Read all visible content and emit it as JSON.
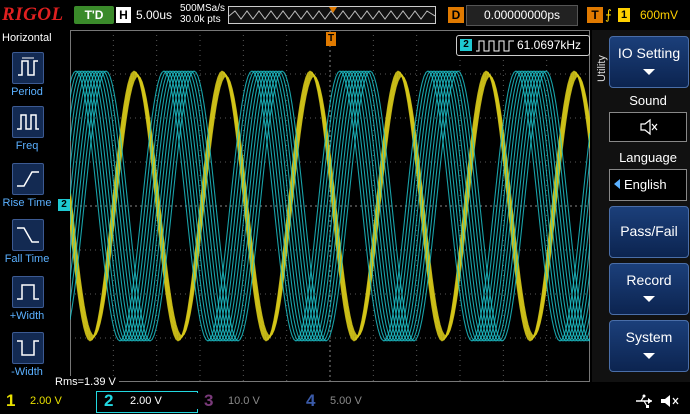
{
  "header": {
    "brand": "RIGOL",
    "run_state": "T'D",
    "h_label": "H",
    "timebase": "5.00us",
    "sample_rate": "500MSa/s",
    "memory_depth": "30.0k pts",
    "d_label": "D",
    "delay": "0.00000000ps",
    "t_label": "T",
    "trigger_channel": "1",
    "trigger_level": "600mV"
  },
  "sidebar": {
    "title": "Horizontal",
    "items": [
      {
        "label": "Period",
        "icon": "period-icon"
      },
      {
        "label": "Freq",
        "icon": "freq-icon"
      },
      {
        "label": "Rise Time",
        "icon": "rise-time-icon"
      },
      {
        "label": "Fall Time",
        "icon": "fall-time-icon"
      },
      {
        "label": "+Width",
        "icon": "pos-width-icon"
      },
      {
        "label": "-Width",
        "icon": "neg-width-icon"
      }
    ]
  },
  "screen": {
    "ch2_marker": "2",
    "trigger_marker": "T",
    "frequency_badge": "2",
    "frequency": "61.0697kHz",
    "rms": "Rms=1.39 V"
  },
  "menu": {
    "side_label": "Utility",
    "io_setting": "IO Setting",
    "sound": "Sound",
    "language": "Language",
    "language_value": "English",
    "pass_fail": "Pass/Fail",
    "record": "Record",
    "system": "System"
  },
  "channels": [
    {
      "num": "1",
      "scale": "2.00 V",
      "color": "#e8e000"
    },
    {
      "num": "2",
      "scale": "2.00 V",
      "color": "#22d8e0"
    },
    {
      "num": "3",
      "scale": "10.0 V",
      "color": "#c040c0"
    },
    {
      "num": "4",
      "scale": "5.00 V",
      "color": "#3a6ae8"
    }
  ],
  "colors": {
    "ch1": "#d6c81a",
    "ch2": "#1ec9d2",
    "accent": "#e07a00"
  }
}
